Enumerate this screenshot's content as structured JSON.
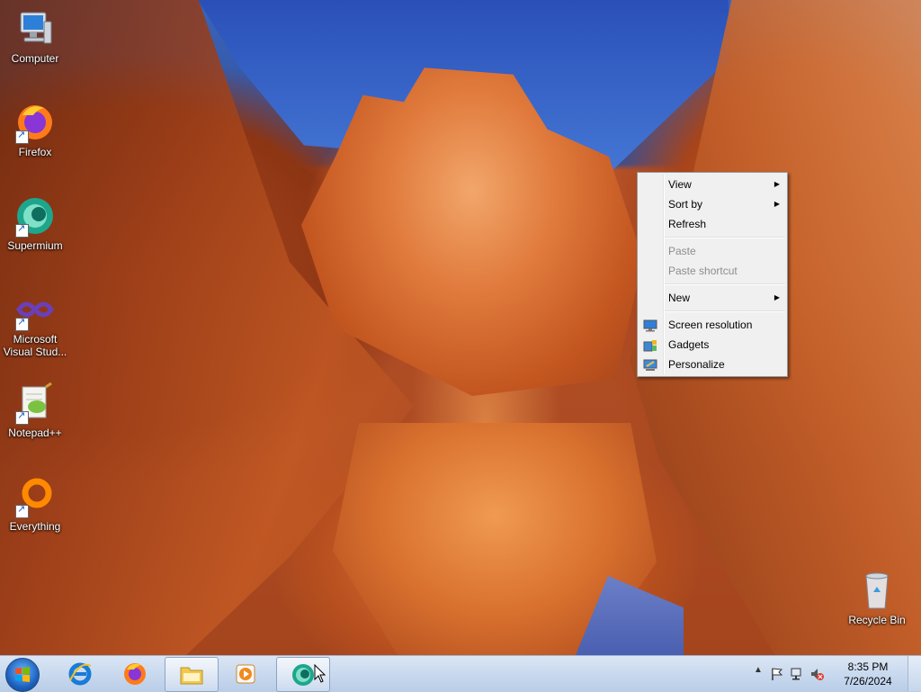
{
  "desktop": {
    "icons": [
      {
        "label": "Computer"
      },
      {
        "label": "Firefox"
      },
      {
        "label": "Supermium"
      },
      {
        "label": "Microsoft Visual Stud..."
      },
      {
        "label": "Notepad++"
      },
      {
        "label": "Everything"
      },
      {
        "label": "Recycle Bin"
      }
    ]
  },
  "context_menu": {
    "items": [
      {
        "label": "View"
      },
      {
        "label": "Sort by"
      },
      {
        "label": "Refresh"
      },
      {
        "label": "Paste"
      },
      {
        "label": "Paste shortcut"
      },
      {
        "label": "New"
      },
      {
        "label": "Screen resolution"
      },
      {
        "label": "Gadgets"
      },
      {
        "label": "Personalize"
      }
    ]
  },
  "taskbar": {
    "clock": {
      "time": "8:35 PM",
      "date": "7/26/2024"
    }
  }
}
